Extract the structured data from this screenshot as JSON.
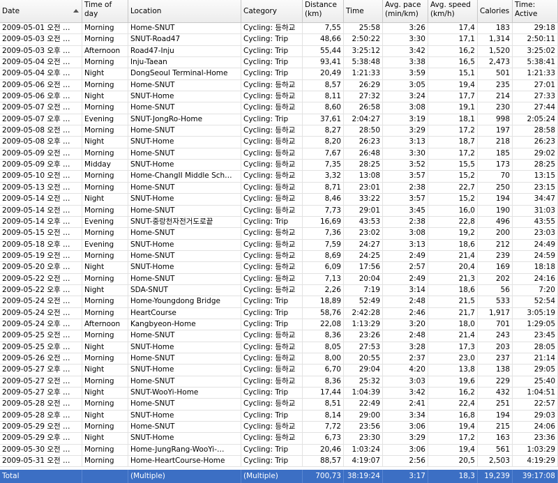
{
  "columns": [
    {
      "label": "Date"
    },
    {
      "label": "Time of day"
    },
    {
      "label": "Location"
    },
    {
      "label": "Category"
    },
    {
      "label": "Distance (km)"
    },
    {
      "label": "Time"
    },
    {
      "label": "Avg. pace (min/km)"
    },
    {
      "label": "Avg. speed (km/h)"
    },
    {
      "label": "Calories"
    },
    {
      "label": "Time: Active"
    }
  ],
  "rows": [
    [
      "2009-05-01 오전 …",
      "Morning",
      "Home-SNUT",
      "Cycling: 등하교",
      "7,55",
      "25:58",
      "3:26",
      "17,4",
      "183",
      "29:18"
    ],
    [
      "2009-05-03 오전 …",
      "Morning",
      "SNUT-Road47",
      "Cycling: Trip",
      "48,66",
      "2:50:22",
      "3:30",
      "17,1",
      "1,314",
      "2:50:11"
    ],
    [
      "2009-05-03 오후 …",
      "Afternoon",
      "Road47-Inju",
      "Cycling: Trip",
      "55,44",
      "3:25:12",
      "3:42",
      "16,2",
      "1,520",
      "3:25:02"
    ],
    [
      "2009-05-04 오전 …",
      "Morning",
      "Inju-Taean",
      "Cycling: Trip",
      "93,41",
      "5:38:48",
      "3:38",
      "16,5",
      "2,473",
      "5:38:41"
    ],
    [
      "2009-05-04 오후 …",
      "Night",
      "DongSeoul Terminal-Home",
      "Cycling: Trip",
      "20,49",
      "1:21:33",
      "3:59",
      "15,1",
      "501",
      "1:21:33"
    ],
    [
      "2009-05-06 오전 …",
      "Morning",
      "Home-SNUT",
      "Cycling: 등하교",
      "8,57",
      "26:29",
      "3:05",
      "19,4",
      "235",
      "27:01"
    ],
    [
      "2009-05-06 오후 …",
      "Night",
      "SNUT-Home",
      "Cycling: 등하교",
      "8,11",
      "27:32",
      "3:24",
      "17,7",
      "214",
      "27:33"
    ],
    [
      "2009-05-07 오전 …",
      "Morning",
      "Home-SNUT",
      "Cycling: 등하교",
      "8,60",
      "26:58",
      "3:08",
      "19,1",
      "230",
      "27:44"
    ],
    [
      "2009-05-07 오후 …",
      "Evening",
      "SNUT-JongRo-Home",
      "Cycling: Trip",
      "37,61",
      "2:04:27",
      "3:19",
      "18,1",
      "998",
      "2:05:24"
    ],
    [
      "2009-05-08 오전 …",
      "Morning",
      "Home-SNUT",
      "Cycling: 등하교",
      "8,27",
      "28:50",
      "3:29",
      "17,2",
      "197",
      "28:58"
    ],
    [
      "2009-05-08 오후 …",
      "Night",
      "SNUT-Home",
      "Cycling: 등하교",
      "8,20",
      "26:23",
      "3:13",
      "18,7",
      "218",
      "26:23"
    ],
    [
      "2009-05-09 오전 …",
      "Morning",
      "Home-SNUT",
      "Cycling: 등하교",
      "7,67",
      "26:48",
      "3:30",
      "17,2",
      "185",
      "29:02"
    ],
    [
      "2009-05-09 오후 …",
      "Midday",
      "SNUT-Home",
      "Cycling: 등하교",
      "7,35",
      "28:25",
      "3:52",
      "15,5",
      "173",
      "28:25"
    ],
    [
      "2009-05-10 오전 …",
      "Morning",
      "Home-ChangII Middle Sch…",
      "Cycling: 등하교",
      "3,32",
      "13:08",
      "3:57",
      "15,2",
      "70",
      "13:15"
    ],
    [
      "2009-05-13 오전 …",
      "Morning",
      "Home-SNUT",
      "Cycling: 등하교",
      "8,71",
      "23:01",
      "2:38",
      "22,7",
      "250",
      "23:15"
    ],
    [
      "2009-05-14 오전 …",
      "Night",
      "SNUT-Home",
      "Cycling: 등하교",
      "8,46",
      "33:22",
      "3:57",
      "15,2",
      "194",
      "34:47"
    ],
    [
      "2009-05-14 오전 …",
      "Morning",
      "Home-SNUT",
      "Cycling: 등하교",
      "7,73",
      "29:01",
      "3:45",
      "16,0",
      "190",
      "31:03"
    ],
    [
      "2009-05-14 오후 …",
      "Evening",
      "SNUT-중랑천자전거도로끝",
      "Cycling: Trip",
      "16,69",
      "43:53",
      "2:38",
      "22,8",
      "496",
      "43:55"
    ],
    [
      "2009-05-15 오전 …",
      "Morning",
      "Home-SNUT",
      "Cycling: 등하교",
      "7,36",
      "23:02",
      "3:08",
      "19,2",
      "200",
      "23:03"
    ],
    [
      "2009-05-18 오후 …",
      "Evening",
      "SNUT-Home",
      "Cycling: 등하교",
      "7,59",
      "24:27",
      "3:13",
      "18,6",
      "212",
      "24:49"
    ],
    [
      "2009-05-19 오전 …",
      "Morning",
      "Home-SNUT",
      "Cycling: 등하교",
      "8,69",
      "24:25",
      "2:49",
      "21,4",
      "239",
      "24:59"
    ],
    [
      "2009-05-20 오후 …",
      "Night",
      "SNUT-Home",
      "Cycling: 등하교",
      "6,09",
      "17:56",
      "2:57",
      "20,4",
      "169",
      "18:18"
    ],
    [
      "2009-05-22 오전 …",
      "Morning",
      "Home-SNUT",
      "Cycling: 등하교",
      "7,13",
      "20:04",
      "2:49",
      "21,3",
      "202",
      "24:16"
    ],
    [
      "2009-05-22 오후 …",
      "Night",
      "SDA-SNUT",
      "Cycling: 등하교",
      "2,26",
      "7:19",
      "3:14",
      "18,6",
      "56",
      "7:20"
    ],
    [
      "2009-05-24 오전 …",
      "Morning",
      "Home-Youngdong Bridge",
      "Cycling: Trip",
      "18,89",
      "52:49",
      "2:48",
      "21,5",
      "533",
      "52:54"
    ],
    [
      "2009-05-24 오전 …",
      "Morning",
      "HeartCourse",
      "Cycling: Trip",
      "58,76",
      "2:42:28",
      "2:46",
      "21,7",
      "1,917",
      "3:05:19"
    ],
    [
      "2009-05-24 오후 …",
      "Afternoon",
      "Kangbyeon-Home",
      "Cycling: Trip",
      "22,08",
      "1:13:29",
      "3:20",
      "18,0",
      "701",
      "1:29:05"
    ],
    [
      "2009-05-25 오전 …",
      "Morning",
      "Home-SNUT",
      "Cycling: 등하교",
      "8,36",
      "23:26",
      "2:48",
      "21,4",
      "243",
      "23:45"
    ],
    [
      "2009-05-25 오후 …",
      "Night",
      "SNUT-Home",
      "Cycling: 등하교",
      "8,05",
      "27:53",
      "3:28",
      "17,3",
      "203",
      "28:05"
    ],
    [
      "2009-05-26 오전 …",
      "Morning",
      "Home-SNUT",
      "Cycling: 등하교",
      "8,00",
      "20:55",
      "2:37",
      "23,0",
      "237",
      "21:14"
    ],
    [
      "2009-05-27 오후 …",
      "Night",
      "SNUT-Home",
      "Cycling: 등하교",
      "6,70",
      "29:04",
      "4:20",
      "13,8",
      "138",
      "29:05"
    ],
    [
      "2009-05-27 오전 …",
      "Morning",
      "Home-SNUT",
      "Cycling: 등하교",
      "8,36",
      "25:32",
      "3:03",
      "19,6",
      "229",
      "25:40"
    ],
    [
      "2009-05-27 오후 …",
      "Night",
      "SNUT-WooYi-Home",
      "Cycling: Trip",
      "17,44",
      "1:04:39",
      "3:42",
      "16,2",
      "432",
      "1:04:51"
    ],
    [
      "2009-05-28 오전 …",
      "Morning",
      "Home-SNUT",
      "Cycling: 등하교",
      "8,51",
      "22:49",
      "2:41",
      "22,4",
      "251",
      "22:57"
    ],
    [
      "2009-05-28 오후 …",
      "Night",
      "SNUT-Home",
      "Cycling: Trip",
      "8,14",
      "29:00",
      "3:34",
      "16,8",
      "194",
      "29:03"
    ],
    [
      "2009-05-29 오전 …",
      "Morning",
      "Home-SNUT",
      "Cycling: 등하교",
      "7,72",
      "23:56",
      "3:06",
      "19,4",
      "215",
      "24:06"
    ],
    [
      "2009-05-29 오후 …",
      "Night",
      "SNUT-Home",
      "Cycling: 등하교",
      "6,73",
      "23:30",
      "3:29",
      "17,2",
      "163",
      "23:36"
    ],
    [
      "2009-05-30 오전 …",
      "Morning",
      "Home-JungRang-WooYi-…",
      "Cycling: Trip",
      "20,46",
      "1:03:24",
      "3:06",
      "19,4",
      "561",
      "1:03:29"
    ],
    [
      "2009-05-31 오전 …",
      "Morning",
      "Home-HeartCourse-Home",
      "Cycling: Trip",
      "88,57",
      "4:19:07",
      "2:56",
      "20,5",
      "2,503",
      "4:19:29"
    ]
  ],
  "total": [
    "Total",
    "",
    "(Multiple)",
    "(Multiple)",
    "700,73",
    "38:19:24",
    "3:17",
    "18,3",
    "19,239",
    "39:17:08"
  ],
  "colors": {
    "total_bg": "#3c6fc4",
    "header_bg": "#f3f3f3"
  }
}
